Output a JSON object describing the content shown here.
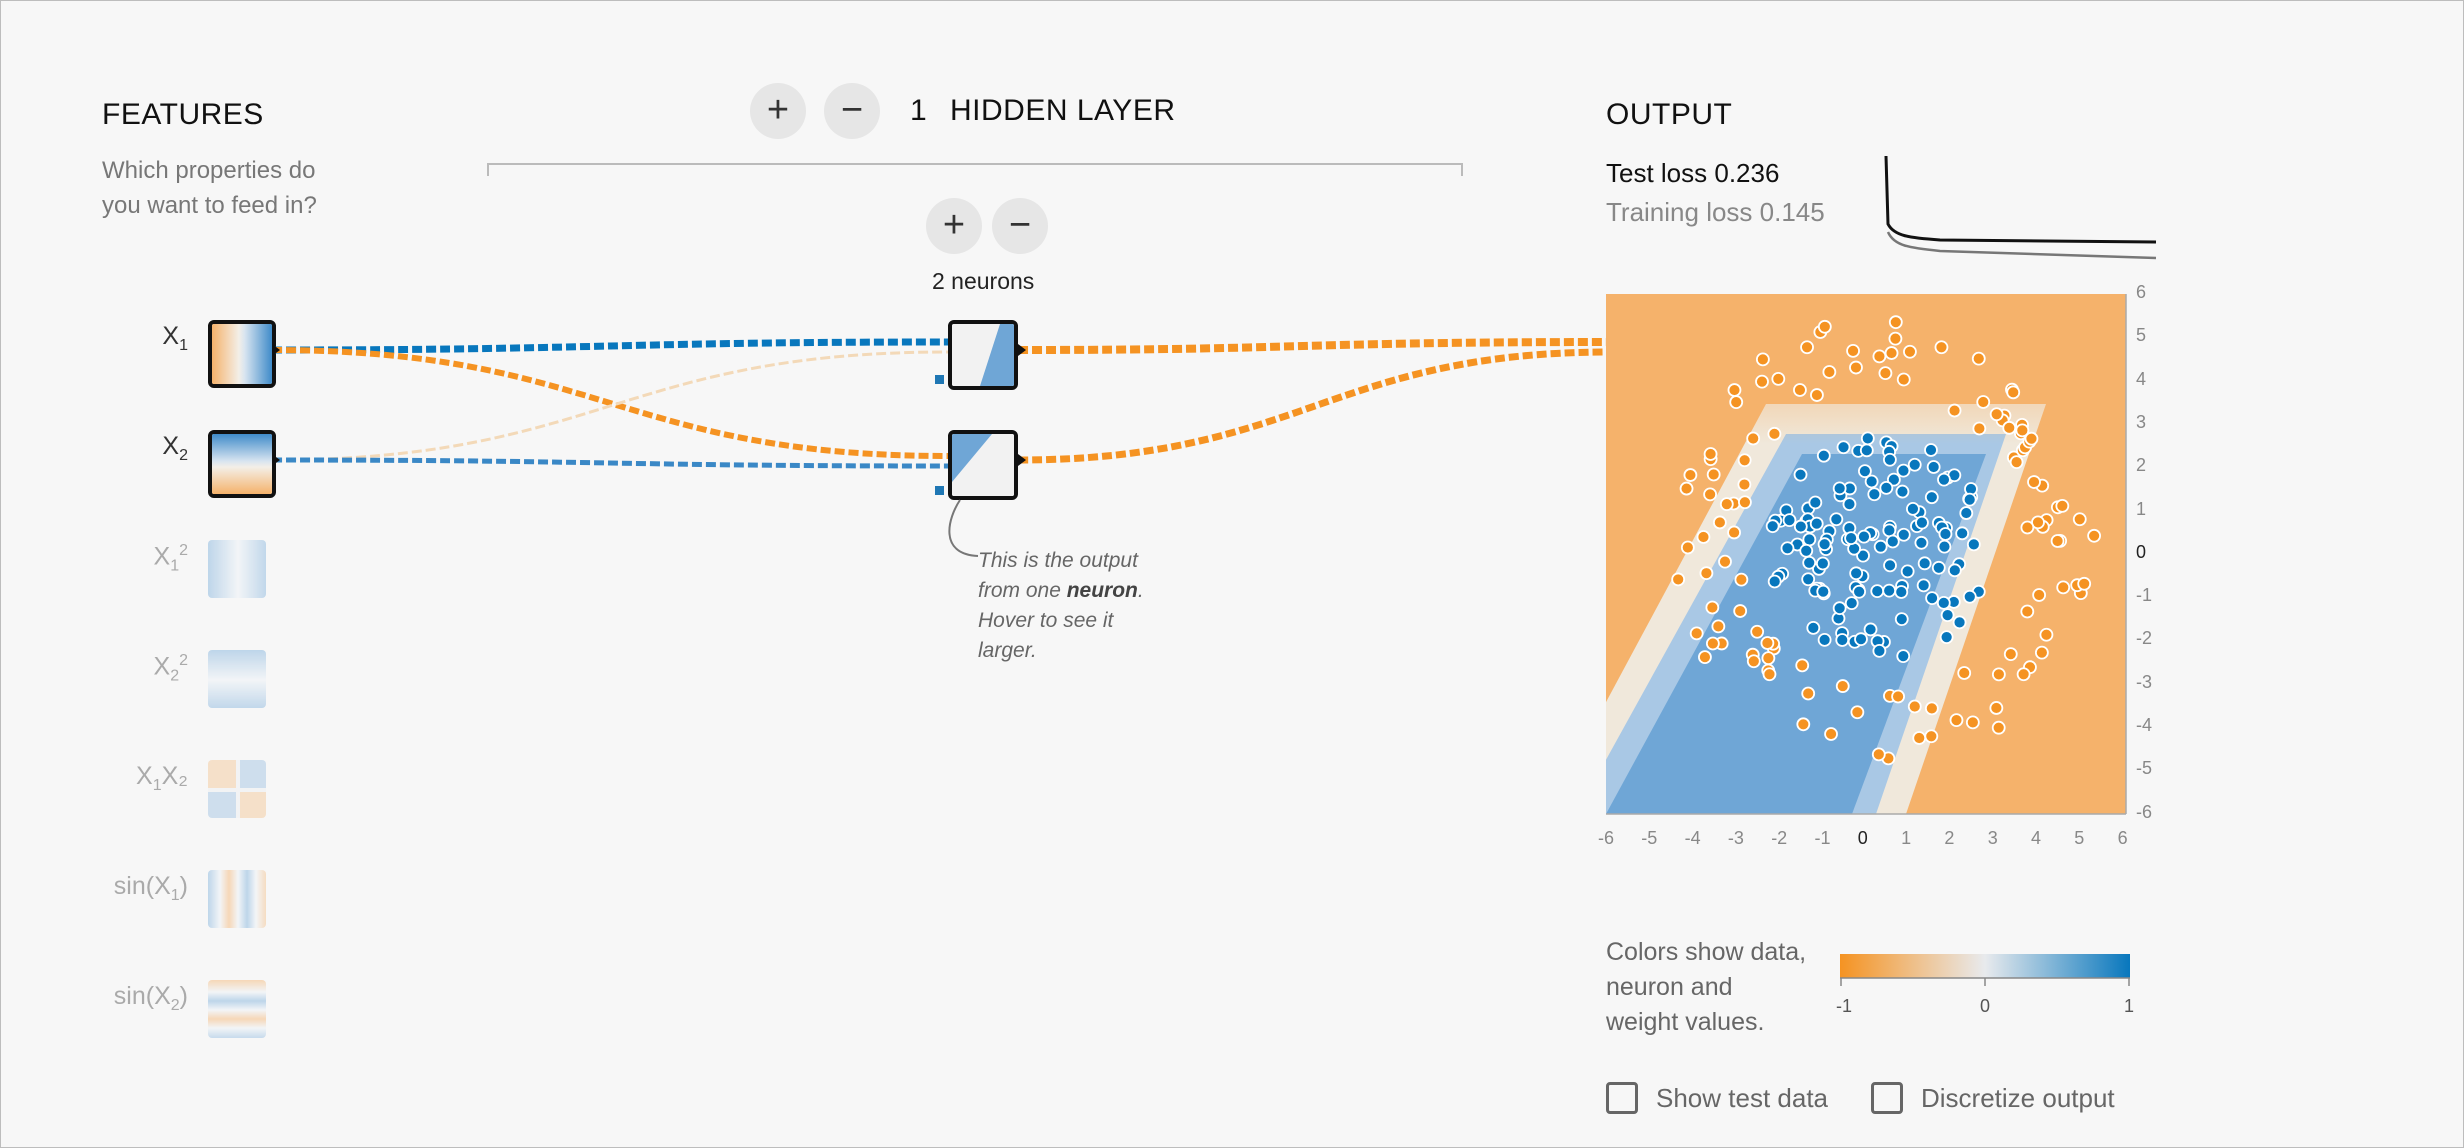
{
  "features": {
    "title": "FEATURES",
    "subtitle_line1": "Which properties do",
    "subtitle_line2": "you want to feed in?",
    "items": [
      {
        "base": "X",
        "sub": "1",
        "sup": "",
        "tail": "",
        "active": true
      },
      {
        "base": "X",
        "sub": "2",
        "sup": "",
        "tail": "",
        "active": true
      },
      {
        "base": "X",
        "sub": "1",
        "sup": "2",
        "tail": "",
        "active": false
      },
      {
        "base": "X",
        "sub": "2",
        "sup": "2",
        "tail": "",
        "active": false
      },
      {
        "base": "X",
        "sub": "1",
        "sup": "",
        "tail": "X₂",
        "active": false
      },
      {
        "base": "sin(X",
        "sub": "1",
        "sup": "",
        "tail": ")",
        "active": false
      },
      {
        "base": "sin(X",
        "sub": "2",
        "sup": "",
        "tail": ")",
        "active": false
      }
    ]
  },
  "hidden_layers": {
    "count": "1",
    "label": "HIDDEN LAYER",
    "add_icon": "plus-icon",
    "remove_icon": "minus-icon",
    "layer": {
      "neurons_label": "2 neurons"
    }
  },
  "annotation": {
    "pre": "This is the output",
    "line2_pre": "from one ",
    "line2_bold": "neuron",
    "line2_post": ".",
    "line3": "Hover to see it",
    "line4": "larger."
  },
  "output": {
    "title": "OUTPUT",
    "test_loss": "Test loss 0.236",
    "training_loss": "Training loss 0.145",
    "x_ticks": [
      "-6",
      "-5",
      "-4",
      "-3",
      "-2",
      "-1",
      "0",
      "1",
      "2",
      "3",
      "4",
      "5",
      "6"
    ],
    "y_ticks": [
      "6",
      "5",
      "4",
      "3",
      "2",
      "1",
      "0",
      "-1",
      "-2",
      "-3",
      "-4",
      "-5",
      "-6"
    ]
  },
  "legend": {
    "line1": "Colors show data,",
    "line2": "neuron and",
    "line3": "weight values.",
    "min": "-1",
    "mid": "0",
    "max": "1"
  },
  "options": {
    "show_test_data": "Show test data",
    "discretize_output": "Discretize output"
  },
  "colors": {
    "orange": "#f59322",
    "blue": "#0877bd",
    "background": "#f7f7f7"
  }
}
